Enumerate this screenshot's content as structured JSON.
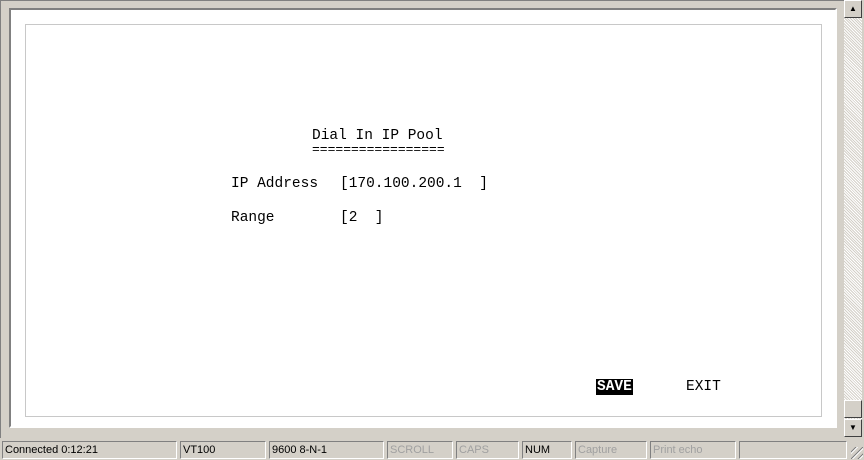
{
  "screen": {
    "title": "Dial In IP Pool",
    "underline": "=================",
    "ip_label": "IP Address",
    "ip_value": "[170.100.200.1  ]",
    "range_label": "Range",
    "range_value": "[2  ]",
    "save_label": "SAVE",
    "exit_label": "EXIT"
  },
  "scrollbar": {
    "up_icon": "arrow-up-icon",
    "down_icon": "arrow-down-icon"
  },
  "status": {
    "connected": "Connected 0:12:21",
    "emulation": "VT100",
    "port": "9600 8-N-1",
    "scroll": "SCROLL",
    "caps": "CAPS",
    "num": "NUM",
    "capture": "Capture",
    "print_echo": "Print echo"
  }
}
